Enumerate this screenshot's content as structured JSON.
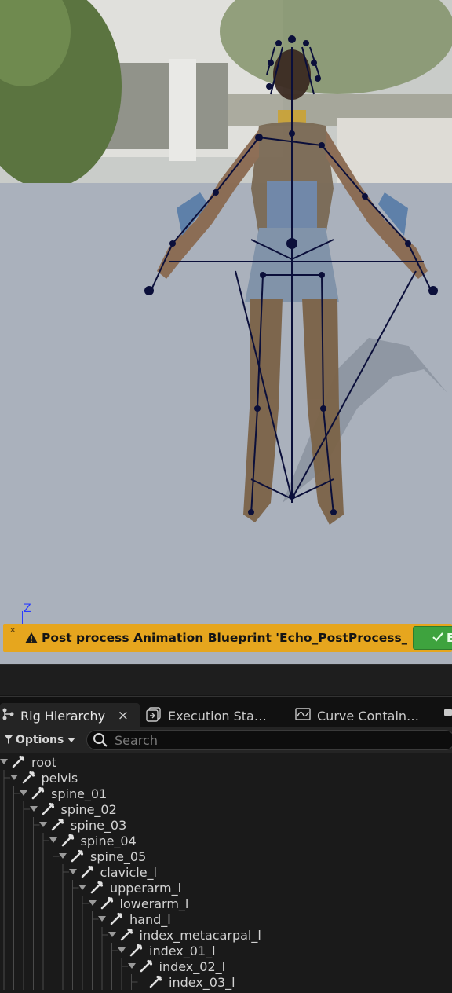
{
  "viewport": {
    "axis_label": "Z",
    "warning": {
      "close_glyph": "×",
      "message": "Post process Animation Blueprint 'Echo_PostProcess_Anim",
      "action_label": "E"
    }
  },
  "tabs": [
    {
      "label": "Rig Hierarchy",
      "icon": "rig-hierarchy-icon",
      "active": true,
      "close": "×"
    },
    {
      "label": "Execution Sta…",
      "icon": "execution-stack-icon",
      "active": false
    },
    {
      "label": "Curve Contain…",
      "icon": "curve-container-icon",
      "active": false
    }
  ],
  "toolbar": {
    "options_label": "Options",
    "search_placeholder": "Search"
  },
  "tree": [
    {
      "label": "root",
      "depth": 0
    },
    {
      "label": "pelvis",
      "depth": 1
    },
    {
      "label": "spine_01",
      "depth": 2
    },
    {
      "label": "spine_02",
      "depth": 3
    },
    {
      "label": "spine_03",
      "depth": 4
    },
    {
      "label": "spine_04",
      "depth": 5
    },
    {
      "label": "spine_05",
      "depth": 6
    },
    {
      "label": "clavicle_l",
      "depth": 7
    },
    {
      "label": "upperarm_l",
      "depth": 8
    },
    {
      "label": "lowerarm_l",
      "depth": 9
    },
    {
      "label": "hand_l",
      "depth": 10
    },
    {
      "label": "index_metacarpal_l",
      "depth": 11
    },
    {
      "label": "index_01_l",
      "depth": 12
    },
    {
      "label": "index_02_l",
      "depth": 13
    },
    {
      "label": "index_03_l",
      "depth": 14
    }
  ],
  "colors": {
    "warning_bg": "#e6a61e",
    "ok_bg": "#3ea33e",
    "skeleton": "#0b0f3a",
    "axis": "#2a3cff"
  }
}
